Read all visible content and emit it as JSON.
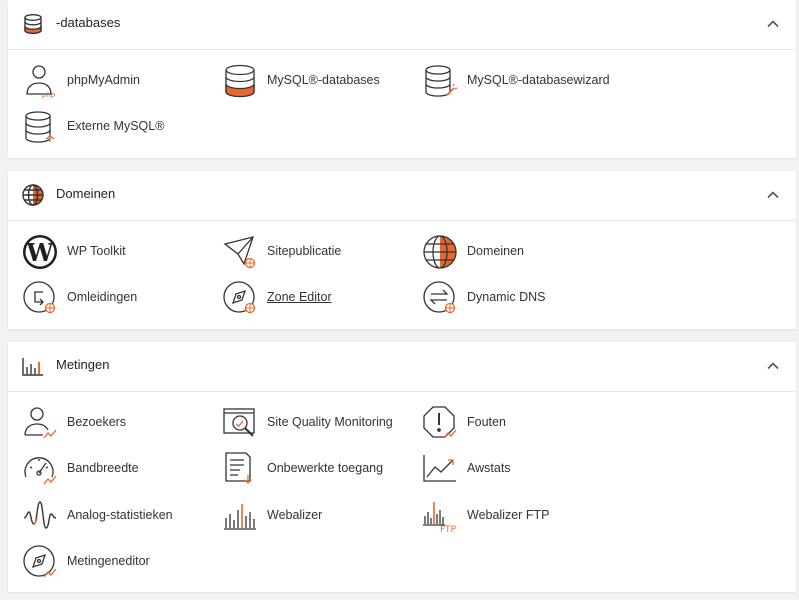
{
  "colors": {
    "accent": "#e8692e",
    "icon_stroke": "#333333",
    "panel_bg": "#ffffff",
    "page_bg": "#f2f2f2"
  },
  "sections": [
    {
      "title": "-databases",
      "icon": "database-icon",
      "items": [
        {
          "label": "phpMyAdmin",
          "icon": "user-php-icon"
        },
        {
          "label": "MySQL®-databases",
          "icon": "database-icon"
        },
        {
          "label": "MySQL®-databasewizard",
          "icon": "database-wizard-icon"
        },
        {
          "label": "Externe MySQL®",
          "icon": "database-external-icon"
        }
      ]
    },
    {
      "title": "Domeinen",
      "icon": "globe-icon",
      "items": [
        {
          "label": "WP Toolkit",
          "icon": "wordpress-icon"
        },
        {
          "label": "Sitepublicatie",
          "icon": "paper-plane-icon"
        },
        {
          "label": "Domeinen",
          "icon": "globe-icon"
        },
        {
          "label": "Omleidingen",
          "icon": "redirect-icon"
        },
        {
          "label": "Zone Editor",
          "icon": "zone-editor-icon"
        },
        {
          "label": "Dynamic DNS",
          "icon": "dynamic-dns-icon"
        }
      ]
    },
    {
      "title": "Metingen",
      "icon": "bar-chart-icon",
      "items": [
        {
          "label": "Bezoekers",
          "icon": "visitors-icon"
        },
        {
          "label": "Site Quality Monitoring",
          "icon": "site-quality-icon"
        },
        {
          "label": "Fouten",
          "icon": "errors-icon"
        },
        {
          "label": "Bandbreedte",
          "icon": "gauge-icon"
        },
        {
          "label": "Onbewerkte toegang",
          "icon": "raw-access-icon"
        },
        {
          "label": "Awstats",
          "icon": "line-chart-icon"
        },
        {
          "label": "Analog-statistieken",
          "icon": "waveform-icon"
        },
        {
          "label": "Webalizer",
          "icon": "webalizer-icon"
        },
        {
          "label": "Webalizer FTP",
          "icon": "webalizer-ftp-icon"
        },
        {
          "label": "Metingeneditor",
          "icon": "metrics-editor-icon"
        }
      ]
    }
  ],
  "ftp_text": "FTP"
}
